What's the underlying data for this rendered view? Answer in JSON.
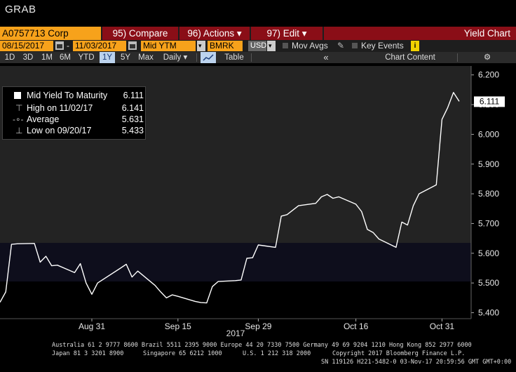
{
  "app": {
    "title": "GRAB"
  },
  "toolbar": {
    "security": "A0757713 Corp",
    "compare": "95) Compare",
    "actions": "96) Actions ▾",
    "edit": "97) Edit ▾",
    "view_title": "Yield Chart"
  },
  "controls": {
    "start_date": "08/15/2017",
    "dash": "-",
    "end_date": "11/03/2017",
    "field": "Mid YTM",
    "benchmark": "BMRK",
    "currency": "USD",
    "mov_avgs": "Mov Avgs",
    "key_events": "Key Events",
    "info_badge": "i"
  },
  "ranges": {
    "items": [
      "1D",
      "3D",
      "1M",
      "6M",
      "YTD",
      "1Y",
      "5Y",
      "Max"
    ],
    "selected": "1Y",
    "periodicity": "Daily ▾",
    "table": "Table",
    "collapse": "«",
    "chart_content": "Chart Content",
    "settings": "⚙"
  },
  "legend": [
    {
      "name": "Mid Yield To Maturity",
      "value": "6.111"
    },
    {
      "name": "High on 11/02/17",
      "value": "6.141"
    },
    {
      "name": "Average",
      "value": "5.631"
    },
    {
      "name": "Low on 09/20/17",
      "value": "5.433"
    }
  ],
  "colors": {
    "accent_amber": "#f7a21b",
    "tab_red": "#8a0e17",
    "line": "#ffffff",
    "plot_bg_upper": "#222222",
    "plot_bg_lower": "#0d0d1a"
  },
  "chart_data": {
    "type": "line",
    "title": "",
    "xlabel": "2017",
    "ylabel": "",
    "ylim": [
      5.38,
      6.23
    ],
    "yticks": [
      "6.200",
      "6.100",
      "6.000",
      "5.900",
      "5.800",
      "5.700",
      "5.600",
      "5.500",
      "5.400"
    ],
    "xticks": [
      {
        "label": "Aug 31",
        "date": "2017-08-31"
      },
      {
        "label": "Sep 15",
        "date": "2017-09-15"
      },
      {
        "label": "Sep 29",
        "date": "2017-09-29"
      },
      {
        "label": "Oct 16",
        "date": "2017-10-16"
      },
      {
        "label": "Oct 31",
        "date": "2017-10-31"
      }
    ],
    "last_value_label": "6.111",
    "series": [
      {
        "name": "Mid Yield To Maturity",
        "points": [
          [
            "2017-08-15",
            5.435
          ],
          [
            "2017-08-16",
            5.47
          ],
          [
            "2017-08-17",
            5.63
          ],
          [
            "2017-08-18",
            5.632
          ],
          [
            "2017-08-21",
            5.633
          ],
          [
            "2017-08-22",
            5.57
          ],
          [
            "2017-08-23",
            5.59
          ],
          [
            "2017-08-24",
            5.558
          ],
          [
            "2017-08-25",
            5.56
          ],
          [
            "2017-08-28",
            5.535
          ],
          [
            "2017-08-29",
            5.565
          ],
          [
            "2017-08-30",
            5.5
          ],
          [
            "2017-08-31",
            5.462
          ],
          [
            "2017-09-01",
            5.5
          ],
          [
            "2017-09-05",
            5.55
          ],
          [
            "2017-09-06",
            5.563
          ],
          [
            "2017-09-07",
            5.52
          ],
          [
            "2017-09-08",
            5.54
          ],
          [
            "2017-09-11",
            5.492
          ],
          [
            "2017-09-12",
            5.47
          ],
          [
            "2017-09-13",
            5.45
          ],
          [
            "2017-09-14",
            5.46
          ],
          [
            "2017-09-15",
            5.455
          ],
          [
            "2017-09-18",
            5.438
          ],
          [
            "2017-09-19",
            5.434
          ],
          [
            "2017-09-20",
            5.433
          ],
          [
            "2017-09-21",
            5.488
          ],
          [
            "2017-09-22",
            5.505
          ],
          [
            "2017-09-25",
            5.508
          ],
          [
            "2017-09-26",
            5.51
          ],
          [
            "2017-09-27",
            5.583
          ],
          [
            "2017-09-28",
            5.585
          ],
          [
            "2017-09-29",
            5.628
          ],
          [
            "2017-10-02",
            5.62
          ],
          [
            "2017-10-03",
            5.725
          ],
          [
            "2017-10-04",
            5.73
          ],
          [
            "2017-10-05",
            5.745
          ],
          [
            "2017-10-06",
            5.76
          ],
          [
            "2017-10-09",
            5.768
          ],
          [
            "2017-10-10",
            5.79
          ],
          [
            "2017-10-11",
            5.798
          ],
          [
            "2017-10-12",
            5.785
          ],
          [
            "2017-10-13",
            5.79
          ],
          [
            "2017-10-16",
            5.765
          ],
          [
            "2017-10-17",
            5.74
          ],
          [
            "2017-10-18",
            5.68
          ],
          [
            "2017-10-19",
            5.67
          ],
          [
            "2017-10-20",
            5.648
          ],
          [
            "2017-10-23",
            5.62
          ],
          [
            "2017-10-24",
            5.705
          ],
          [
            "2017-10-25",
            5.695
          ],
          [
            "2017-10-26",
            5.76
          ],
          [
            "2017-10-27",
            5.8
          ],
          [
            "2017-10-30",
            5.83
          ],
          [
            "2017-10-31",
            6.05
          ],
          [
            "2017-11-01",
            6.09
          ],
          [
            "2017-11-02",
            6.141
          ],
          [
            "2017-11-03",
            6.111
          ]
        ]
      }
    ]
  },
  "footer": {
    "line1": "Australia 61 2 9777 8600 Brazil 5511 2395 9000 Europe 44 20 7330 7500 Germany 49 69 9204 1210 Hong Kong 852 2977 6000",
    "line2a": "Japan 81 3 3201 8900",
    "line2b": "Singapore 65 6212 1000",
    "line2c": "U.S. 1 212 318 2000",
    "line2d": "Copyright 2017 Bloomberg Finance L.P.",
    "line3": "SN 119126 H221-5482-0 03-Nov-17 20:59:56 GMT  GMT+0:00"
  }
}
